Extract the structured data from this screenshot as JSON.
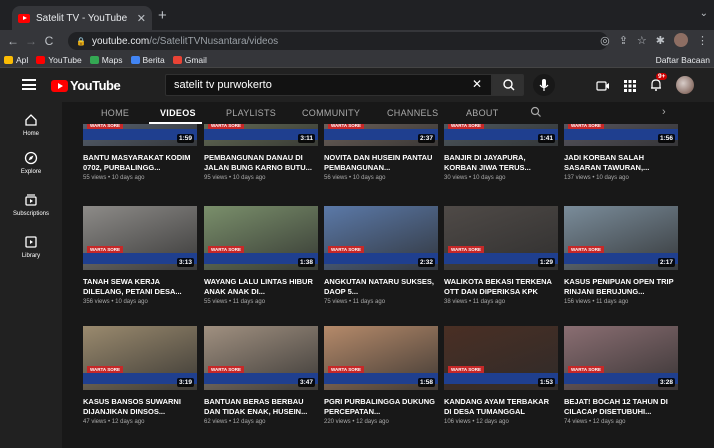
{
  "browser": {
    "tab_title": "Satelit TV - YouTube",
    "url_host": "youtube.com",
    "url_path": "/c/SatelitTVNusantara/videos",
    "bookmarks": [
      {
        "label": "Apl",
        "color": "#fbbc04"
      },
      {
        "label": "YouTube",
        "color": "#ff0000"
      },
      {
        "label": "Maps",
        "color": "#34a853"
      },
      {
        "label": "Berita",
        "color": "#4285f4"
      },
      {
        "label": "Gmail",
        "color": "#ea4335"
      }
    ],
    "reading_list": "Daftar Bacaan"
  },
  "youtube": {
    "search_value": "satelit tv purwokerto",
    "notification_count": "9+"
  },
  "guide": {
    "items": [
      {
        "label": "Home",
        "icon": "home-icon"
      },
      {
        "label": "Explore",
        "icon": "compass-icon"
      },
      {
        "label": "Subscriptions",
        "icon": "subscriptions-icon"
      },
      {
        "label": "Library",
        "icon": "library-icon"
      }
    ]
  },
  "channel_tabs": [
    "HOME",
    "VIDEOS",
    "PLAYLISTS",
    "COMMUNITY",
    "CHANNELS",
    "ABOUT"
  ],
  "active_tab": "VIDEOS",
  "thumb_label": "WARTA SORE",
  "videos": [
    {
      "title": "BANTU MASYARAKAT KODIM 0702, PURBALINGG...",
      "meta": "55 views • 10 days ago",
      "duration": "1:59",
      "color": "#6b7a8f"
    },
    {
      "title": "PEMBANGUNAN DANAU DI JALAN BUNG KARNO BUTU...",
      "meta": "95 views • 10 days ago",
      "duration": "3:11",
      "color": "#7f8a6a"
    },
    {
      "title": "NOVITA DAN HUSEIN PANTAU PEMBANGUNAN...",
      "meta": "56 views • 10 days ago",
      "duration": "2:37",
      "color": "#8a7a70"
    },
    {
      "title": "BANJIR DI JAYAPURA, KORBAN JIWA TERUS...",
      "meta": "30 views • 10 days ago",
      "duration": "1:41",
      "color": "#5f6e78"
    },
    {
      "title": "JADI KORBAN SALAH SASARAN TAWURAN,...",
      "meta": "137 views • 10 days ago",
      "duration": "1:56",
      "color": "#6c6a78"
    },
    {
      "title": "TANAH SEWA KERJA DILELANG, PETANI DESA...",
      "meta": "356 views • 10 days ago",
      "duration": "3:13",
      "color": "#8d8b88"
    },
    {
      "title": "WAYANG LALU LINTAS HIBUR ANAK ANAK DI...",
      "meta": "55 views • 11 days ago",
      "duration": "1:38",
      "color": "#7a8f6b"
    },
    {
      "title": "ANGKUTAN NATARU SUKSES, DAOP 5...",
      "meta": "75 views • 11 days ago",
      "duration": "2:32",
      "color": "#5b79a8"
    },
    {
      "title": "WALIKOTA BEKASI TERKENA OTT DAN DIPERIKSA KPK",
      "meta": "38 views • 11 days ago",
      "duration": "1:29",
      "color": "#4f4a47"
    },
    {
      "title": "KASUS PENIPUAN OPEN TRIP RINJANI BERUJUNG...",
      "meta": "156 views • 11 days ago",
      "duration": "2:17",
      "color": "#7a8c9a"
    },
    {
      "title": "KASUS BANSOS SUWARNI DIJANJIKAN DINSOS...",
      "meta": "47 views • 12 days ago",
      "duration": "3:19",
      "color": "#9a8a6e"
    },
    {
      "title": "BANTUAN BERAS BERBAU DAN TIDAK ENAK, HUSEIN...",
      "meta": "62 views • 12 days ago",
      "duration": "3:47",
      "color": "#a09080"
    },
    {
      "title": "PGRI PURBALINGGA DUKUNG PERCEPATAN...",
      "meta": "220 views • 12 days ago",
      "duration": "1:58",
      "color": "#b58a6a"
    },
    {
      "title": "KANDANG AYAM TERBAKAR DI DESA TUMANGGAL",
      "meta": "106 views • 12 days ago",
      "duration": "1:53",
      "color": "#4a2f24"
    },
    {
      "title": "BEJAT! BOCAH 12 TAHUN DI CILACAP DISETUBUHI...",
      "meta": "74 views • 12 days ago",
      "duration": "3:28",
      "color": "#8a6e72"
    }
  ]
}
